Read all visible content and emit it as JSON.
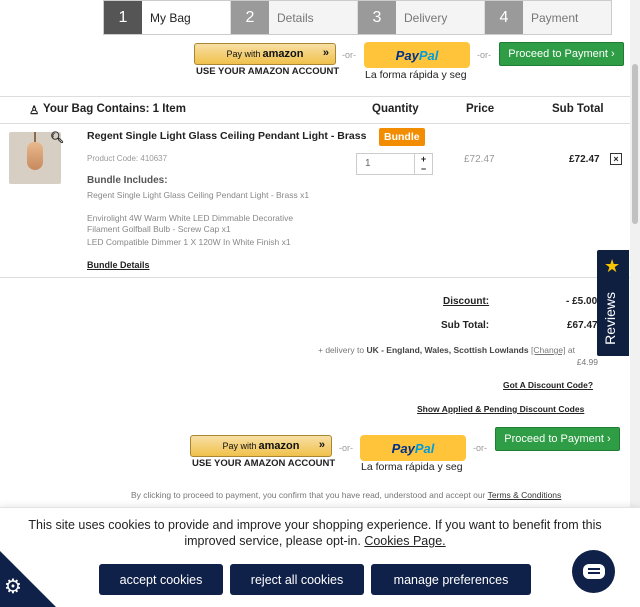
{
  "steps": [
    {
      "num": "1",
      "label": "My Bag"
    },
    {
      "num": "2",
      "label": "Details"
    },
    {
      "num": "3",
      "label": "Delivery"
    },
    {
      "num": "4",
      "label": "Payment"
    }
  ],
  "payment": {
    "amazon_label_prefix": "Pay with",
    "amazon_label_brand": "amazon",
    "amazon_arrows": "»",
    "amazon_sub": "USE YOUR AMAZON ACCOUNT",
    "or": "-or-",
    "paypal_p1": "Pay",
    "paypal_p2": "Pal",
    "paypal_sub": "La forma rápida y seg",
    "proceed": "Proceed to Payment ›"
  },
  "table": {
    "bag_title": "Your Bag Contains: 1 Item",
    "col_quantity": "Quantity",
    "col_price": "Price",
    "col_subtotal": "Sub Total"
  },
  "product": {
    "name": "Regent Single Light Glass Ceiling Pendant Light - Brass",
    "badge": "Bundle",
    "code": "Product Code: 410637",
    "bundle_includes": "Bundle Includes:",
    "bundle_items": [
      "Regent Single Light Glass Ceiling Pendant Light - Brass x1",
      "Envirolight 4W Warm White LED Dimmable Decorative Filament Golfball Bulb - Screw Cap x1",
      "LED Compatible Dimmer 1 X 120W In White Finish x1"
    ],
    "bundle_details": "Bundle Details",
    "quantity": "1",
    "spin_plus": "+",
    "spin_minus": "−",
    "price": "£72.47",
    "subtotal": "£72.47",
    "remove": "×"
  },
  "totals": {
    "discount_label": "Discount:",
    "discount_value": "- £5.00",
    "subtotal_label": "Sub Total:",
    "subtotal_value": "£67.47",
    "delivery_prefix": "+ delivery to",
    "delivery_region": "UK - England, Wales, Scottish Lowlands",
    "change": "[Change]",
    "delivery_suffix": "at",
    "delivery_price": "£4.99",
    "discount_code": "Got A Discount Code?",
    "show_codes": "Show Applied & Pending Discount Codes"
  },
  "disclaimer": {
    "text": "By clicking to proceed to payment, you confirm that you have read, understood and accept our",
    "link": "Terms & Conditions"
  },
  "reviews": {
    "label": "Reviews",
    "icon": "star-icon"
  },
  "cookies": {
    "message": "This site uses cookies to provide and improve your shopping experience. If you want to benefit from this improved service, please opt-in.",
    "link": "Cookies Page.",
    "accept": "accept cookies",
    "reject": "reject all cookies",
    "manage": "manage preferences"
  },
  "colors": {
    "proceed_green": "#2e9d45",
    "bundle_orange": "#f28c00",
    "navy": "#0f2148",
    "paypal_yellow": "#ffc439"
  }
}
